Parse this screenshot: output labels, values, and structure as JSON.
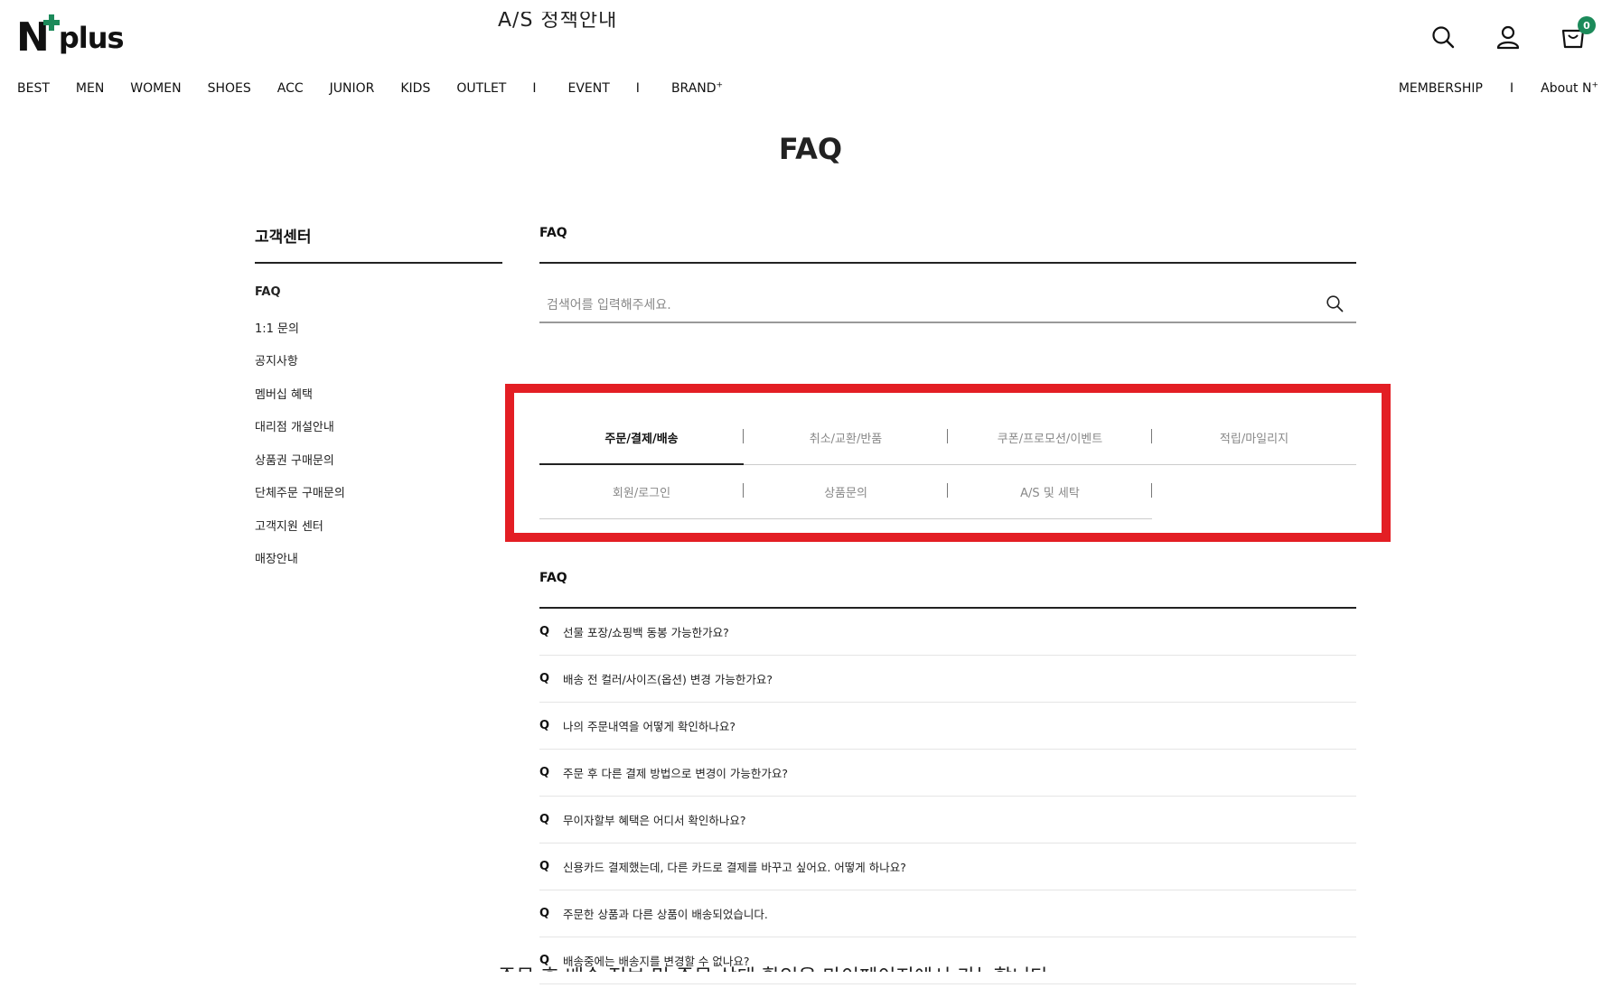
{
  "header": {
    "logo_letter": "N",
    "logo_word": "plus",
    "cart_count": "0",
    "nav": [
      "BEST",
      "MEN",
      "WOMEN",
      "SHOES",
      "ACC",
      "JUNIOR",
      "KIDS",
      "OUTLET",
      "I",
      "EVENT",
      "I",
      "BRAND"
    ],
    "nav_brand_sup": "+",
    "right_nav": {
      "membership": "MEMBERSHIP",
      "sep": "I",
      "about": "About N",
      "about_sup": "+"
    }
  },
  "page_title": "FAQ",
  "sidebar": {
    "title": "고객센터",
    "items": [
      "FAQ",
      "1:1 문의",
      "공지사항",
      "멤버십 혜택",
      "대리점 개설안내",
      "상품권 구매문의",
      "단체주문 구매문의",
      "고객지원 센터",
      "매장안내"
    ]
  },
  "main": {
    "title": "FAQ",
    "search_placeholder": "검색어를 입력해주세요.",
    "tabs_row1": [
      "주문/결제/배송",
      "취소/교환/반품",
      "쿠폰/프로모션/이벤트",
      "적립/마일리지"
    ],
    "tabs_row2": [
      "회원/로그인",
      "상품문의",
      "A/S 및 세탁"
    ],
    "faq_title": "FAQ",
    "faq_q": "Q",
    "faq_items": [
      "선물 포장/쇼핑백 동봉 가능한가요?",
      "배송 전 컬러/사이즈(옵션) 변경 가능한가요?",
      "나의 주문내역을 어떻게 확인하나요?",
      "주문 후 다른 결제 방법으로 변경이 가능한가요?",
      "무이자할부 혜택은 어디서 확인하나요?",
      "신용카드 결제했는데, 다른 카드로 결제를 바꾸고 싶어요. 어떻게 하나요?",
      "주문한 상품과 다른 상품이 배송되었습니다.",
      "배송중에는 배송지를 변경할 수 없나요?"
    ]
  },
  "ghost_top": "A/S 정책안내",
  "ghost_bottom": "주문 후 배송 정보 및 주문 상태 확인은 마이페이지에서 가능합니다",
  "colors": {
    "accent": "#1c8a5a",
    "highlight": "#e31e24"
  }
}
